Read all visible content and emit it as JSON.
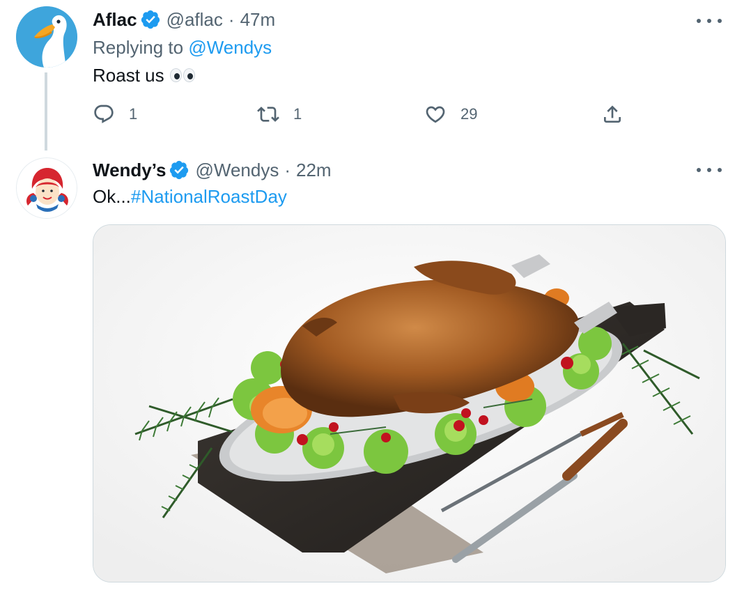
{
  "tweets": [
    {
      "name": "Aflac",
      "handle": "@aflac",
      "time": "47m",
      "replying_prefix": "Replying to ",
      "replying_to": "@Wendys",
      "text": "Roast us",
      "actions": {
        "reply_count": "1",
        "retweet_count": "1",
        "like_count": "29"
      }
    },
    {
      "name": "Wendy’s",
      "handle": "@Wendys",
      "time": "22m",
      "text_prefix": "Ok...",
      "hashtag": "#NationalRoastDay",
      "media_description": "photo"
    }
  ],
  "separator": "·",
  "colors": {
    "link": "#1d9bf0",
    "secondary": "#536471",
    "verified": "#1d9bf0",
    "aflac_avatar_bg": "#3ea5dc",
    "wendys_red": "#d6262f"
  },
  "icons": [
    "verified-icon",
    "more-icon",
    "reply-icon",
    "retweet-icon",
    "like-icon",
    "share-icon"
  ]
}
